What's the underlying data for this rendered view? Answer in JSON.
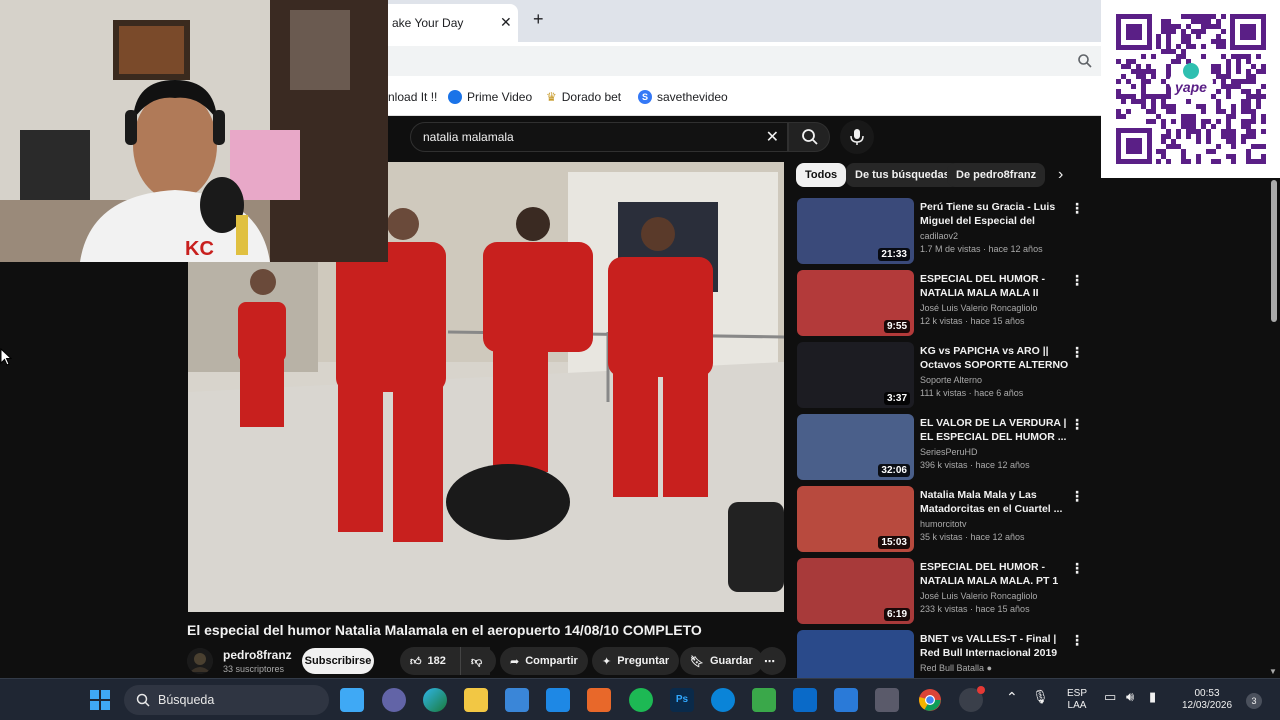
{
  "browser": {
    "tab_title": "ake Your Day",
    "tab_close": "✕",
    "new_tab": "+",
    "bookmarks": [
      {
        "label": "nload It !!",
        "color": "#888888"
      },
      {
        "label": "Prime Video",
        "color": "#1a73e8"
      },
      {
        "label": "Dorado bet",
        "color": "#c79a2a"
      },
      {
        "label": "savethevideo",
        "color": "#3478f6"
      }
    ]
  },
  "youtube": {
    "search_query": "natalia malamala",
    "search_clear": "✕",
    "chips": [
      "Todos",
      "De tus búsquedas",
      "De pedro8franz"
    ],
    "chip_next": "›",
    "video": {
      "title": "El especial del humor Natalia Malamala en el aeropuerto 14/08/10 COMPLETO",
      "channel": "pedro8franz",
      "subscribers": "33 suscriptores",
      "subscribe_label": "Subscribirse",
      "likes": "182",
      "share_label": "Compartir",
      "ask_label": "Preguntar",
      "save_label": "Guardar",
      "more": "⋯"
    },
    "recommendations": [
      {
        "title": "Perú Tiene su Gracia - Luis Miguel del Especial del Humor...",
        "channel": "cadilaov2",
        "meta": "1.7 M de vistas · hace 12 años",
        "duration": "21:33",
        "color": "#3a4a7a",
        "verified": false
      },
      {
        "title": "ESPECIAL DEL HUMOR - NATALIA MALA MALA II (Part...",
        "channel": "José Luis Valerio Roncagliolo",
        "meta": "12 k vistas · hace 15 años",
        "duration": "9:55",
        "color": "#b33a3a",
        "verified": false
      },
      {
        "title": "KG vs PAPICHA vs ARO || Octavos SOPORTE ALTERNO",
        "channel": "Soporte Alterno",
        "meta": "111 k vistas · hace 6 años",
        "duration": "3:37",
        "color": "#1c1c22",
        "verified": false
      },
      {
        "title": "EL VALOR DE LA VERDURA | EL ESPECIAL DEL HUMOR ...",
        "channel": "SeriesPeruHD",
        "meta": "396 k vistas · hace 12 años",
        "duration": "32:06",
        "color": "#4a5f8a",
        "verified": false
      },
      {
        "title": "Natalia Mala Mala y Las Matadorcitas en el Cuartel ...",
        "channel": "humorcitotv",
        "meta": "35 k vistas · hace 12 años",
        "duration": "15:03",
        "color": "#b84a3e",
        "verified": false
      },
      {
        "title": "ESPECIAL DEL HUMOR - NATALIA MALA MALA. PT 1",
        "channel": "José Luis Valerio Roncagliolo",
        "meta": "233 k vistas · hace 15 años",
        "duration": "6:19",
        "color": "#a83a3a",
        "verified": false
      },
      {
        "title": "BNET vs VALLES-T - Final | Red Bull Internacional 2019",
        "channel": "Red Bull Batalla",
        "meta": "",
        "duration": "",
        "color": "#2a4a8a",
        "verified": true
      }
    ]
  },
  "taskbar": {
    "search_placeholder": "Búsqueda",
    "language_top": "ESP",
    "language_bottom": "LAA",
    "time": "00:53",
    "date": "12/03/2026",
    "notifications": "3"
  }
}
